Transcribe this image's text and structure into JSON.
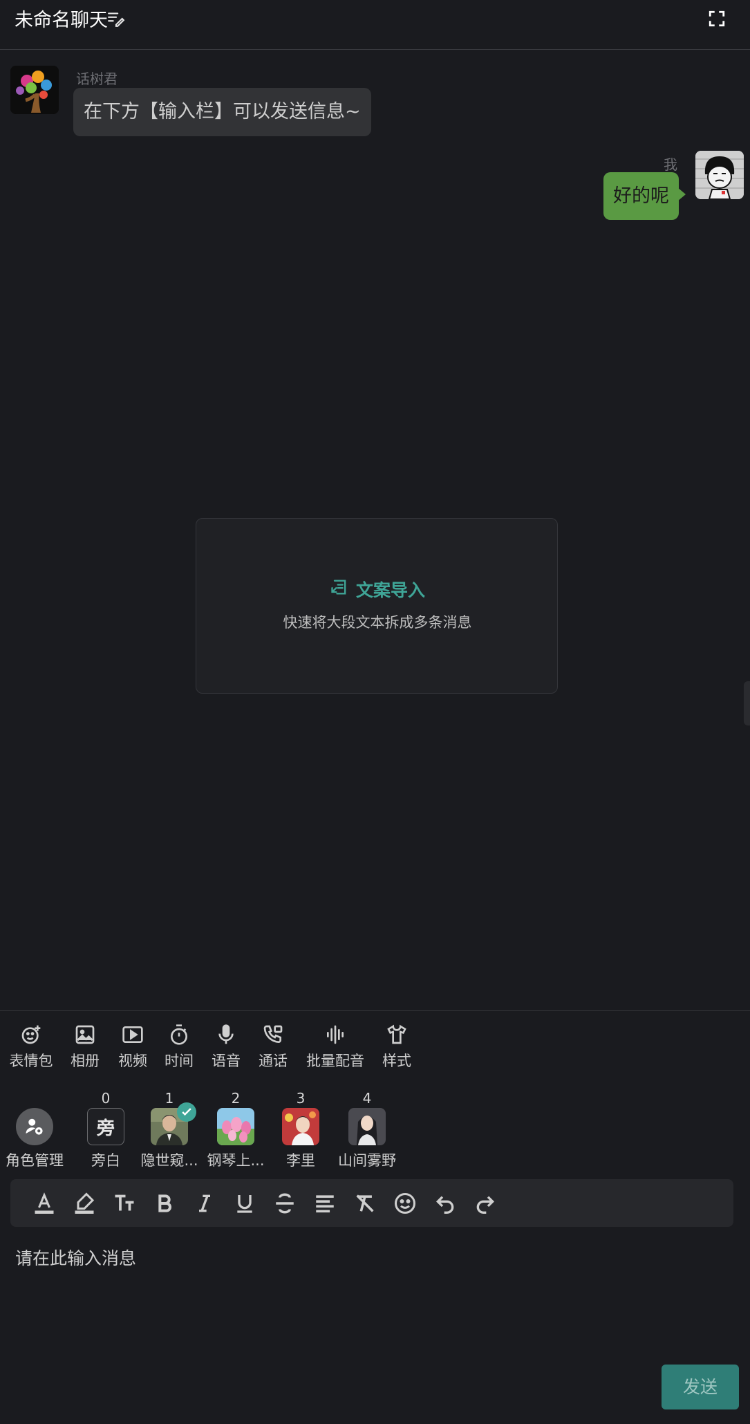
{
  "header": {
    "title": "未命名聊天"
  },
  "messages": [
    {
      "side": "left",
      "sender": "话树君",
      "text": "在下方【输入栏】可以发送信息~"
    },
    {
      "side": "right",
      "sender": "我",
      "text": "好的呢"
    }
  ],
  "import_card": {
    "title": "文案导入",
    "description": "快速将大段文本拆成多条消息"
  },
  "toolbar": {
    "items": [
      {
        "label": "表情包",
        "icon": "emoji-add-icon"
      },
      {
        "label": "相册",
        "icon": "image-icon"
      },
      {
        "label": "视频",
        "icon": "video-icon"
      },
      {
        "label": "时间",
        "icon": "timer-icon"
      },
      {
        "label": "语音",
        "icon": "microphone-icon"
      },
      {
        "label": "通话",
        "icon": "phone-call-icon"
      },
      {
        "label": "批量配音",
        "icon": "waveform-icon"
      },
      {
        "label": "样式",
        "icon": "shirt-icon"
      }
    ]
  },
  "roles": {
    "manage_label": "角色管理",
    "items": [
      {
        "number": "0",
        "label": "旁白",
        "badge_text": "旁",
        "selected": false
      },
      {
        "number": "1",
        "label": "隐世窥...",
        "selected": true
      },
      {
        "number": "2",
        "label": "钢琴上...",
        "selected": false
      },
      {
        "number": "3",
        "label": "李里",
        "selected": false
      },
      {
        "number": "4",
        "label": "山间雾野",
        "selected": false
      }
    ]
  },
  "format_bar": {
    "items": [
      "text-color-icon",
      "highlight-icon",
      "font-size-icon",
      "bold-icon",
      "italic-icon",
      "underline-icon",
      "strikethrough-icon",
      "align-icon",
      "clear-format-icon",
      "emoji-icon",
      "undo-icon",
      "redo-icon"
    ]
  },
  "input": {
    "placeholder": "请在此输入消息"
  },
  "send": {
    "label": "发送"
  },
  "colors": {
    "accent": "#2f7e77",
    "my_bubble": "#5a9a43",
    "background": "#1a1b1f"
  }
}
